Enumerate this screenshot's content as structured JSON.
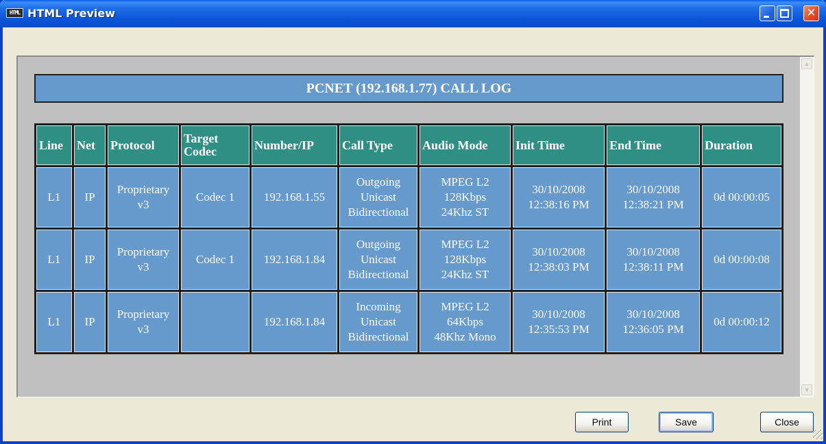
{
  "window": {
    "title": "HTML Preview",
    "app_icon_text": "HTML",
    "close_glyph": "✕"
  },
  "report": {
    "title": "PCNET (192.168.1.77) CALL LOG",
    "headers": [
      "Line",
      "Net",
      "Protocol",
      "Target Codec",
      "Number/IP",
      "Call Type",
      "Audio Mode",
      "Init Time",
      "End Time",
      "Duration"
    ],
    "rows": [
      {
        "line": "L1",
        "net": "IP",
        "protocol": [
          "Proprietary",
          "v3"
        ],
        "target_codec": "Codec 1",
        "number_ip": "192.168.1.55",
        "call_type": [
          "Outgoing",
          "Unicast",
          "Bidirectional"
        ],
        "audio_mode": [
          "MPEG L2",
          "128Kbps",
          "24Khz ST"
        ],
        "init_time": [
          "30/10/2008",
          "12:38:16 PM"
        ],
        "end_time": [
          "30/10/2008",
          "12:38:21 PM"
        ],
        "duration": "0d 00:00:05"
      },
      {
        "line": "L1",
        "net": "IP",
        "protocol": [
          "Proprietary",
          "v3"
        ],
        "target_codec": "Codec 1",
        "number_ip": "192.168.1.84",
        "call_type": [
          "Outgoing",
          "Unicast",
          "Bidirectional"
        ],
        "audio_mode": [
          "MPEG L2",
          "128Kbps",
          "24Khz ST"
        ],
        "init_time": [
          "30/10/2008",
          "12:38:03 PM"
        ],
        "end_time": [
          "30/10/2008",
          "12:38:11 PM"
        ],
        "duration": "0d 00:00:08"
      },
      {
        "line": "L1",
        "net": "IP",
        "protocol": [
          "Proprietary",
          "v3"
        ],
        "target_codec": "",
        "number_ip": "192.168.1.84",
        "call_type": [
          "Incoming",
          "Unicast",
          "Bidirectional"
        ],
        "audio_mode": [
          "MPEG L2",
          "64Kbps",
          "48Khz Mono"
        ],
        "init_time": [
          "30/10/2008",
          "12:35:53 PM"
        ],
        "end_time": [
          "30/10/2008",
          "12:36:05 PM"
        ],
        "duration": "0d 00:00:12"
      }
    ]
  },
  "buttons": {
    "print": "Print",
    "save": "Save",
    "close": "Close"
  },
  "colors": {
    "header_bg": "#2f8f84",
    "cell_bg": "#6699cc",
    "frame_bg": "#c0c0c0"
  }
}
